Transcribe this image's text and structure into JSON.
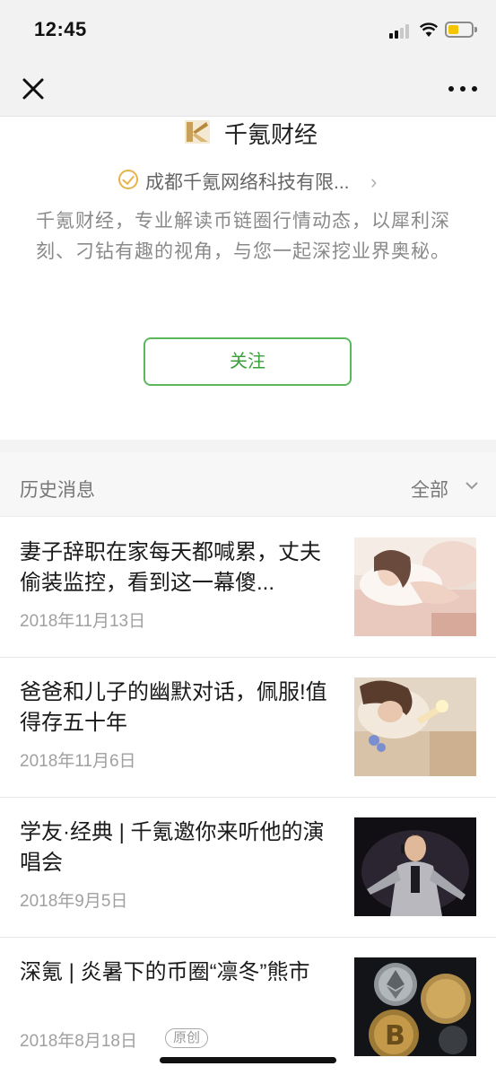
{
  "status_bar": {
    "time": "12:45"
  },
  "nav": {
    "close_icon": "close-icon",
    "more_icon": "more-dots-icon"
  },
  "profile": {
    "name": "千氪财经",
    "logo_icon": "brand-logo-k",
    "verified_icon": "verified-check-icon",
    "company": "成都千氪网络科技有限...",
    "description": "千氪财经，专业解读币链圈行情动态，以犀利深刻、刁钻有趣的视角，与您一起深挖业界奥秘。",
    "follow_label": "关注"
  },
  "history": {
    "title": "历史消息",
    "filter_label": "全部"
  },
  "articles": [
    {
      "title": "妻子辞职在家每天都喊累，丈夫偷装监控，看到这一幕傻...",
      "date": "2018年11月13日",
      "thumbnail": "woman-on-pillow-photo"
    },
    {
      "title": "爸爸和儿子的幽默对话，佩服!值得存五十年",
      "date": "2018年11月6日",
      "thumbnail": "woman-with-sparkler-photo"
    },
    {
      "title": "学友·经典 | 千氪邀你来听他的演唱会",
      "date": "2018年9月5日",
      "thumbnail": "singer-on-stage-photo"
    },
    {
      "title": "深氪 | 炎暑下的币圈“凛冬”熊市",
      "date": "2018年8月18日",
      "badge": "原创",
      "thumbnail": "crypto-coins-photo"
    }
  ],
  "colors": {
    "accent_green": "#3aa13a",
    "verified_gold": "#e8b24b",
    "battery_yellow": "#f4c400"
  }
}
